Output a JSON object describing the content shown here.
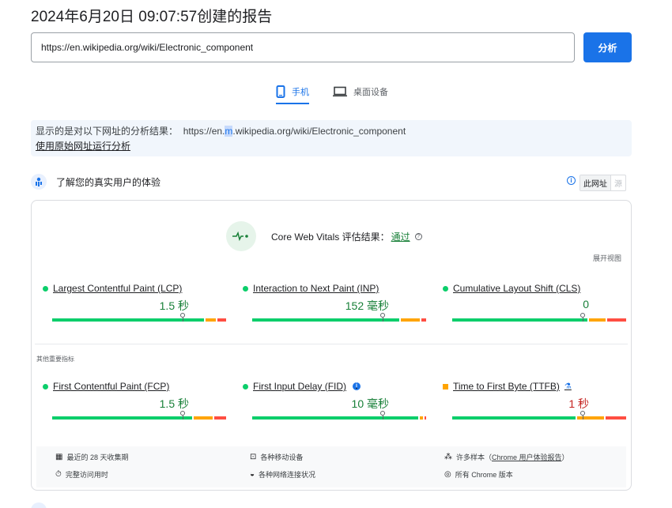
{
  "report_title": "2024年6月20日 09:07:57创建的报告",
  "url_input": "https://en.wikipedia.org/wiki/Electronic_component",
  "analyze_label": "分析",
  "tabs": {
    "mobile": "手机",
    "desktop": "桌面设备"
  },
  "notice": {
    "prefix": "显示的是对以下网址的分析结果：",
    "url_a": "https://en.",
    "url_hl": "m",
    "url_b": ".wikipedia.org/wiki/Electronic_component",
    "link": "使用原始网址运行分析"
  },
  "section": {
    "title": "了解您的真实用户的体验",
    "toggle_on": "此网址",
    "toggle_off": "源"
  },
  "cwv": {
    "label": "Core Web Vitals 评估结果：",
    "result": "通过"
  },
  "expand_label": "展开视图",
  "other_label": "其他重要指标",
  "metrics": [
    {
      "name": "Largest Contentful Paint (LCP)",
      "value": "1.5 秒",
      "status": "good",
      "marker": 0.75,
      "split": [
        0.89,
        0.06,
        0.05
      ]
    },
    {
      "name": "Interaction to Next Paint (INP)",
      "value": "152 毫秒",
      "status": "good",
      "marker": 0.75,
      "split": [
        0.86,
        0.11,
        0.03
      ]
    },
    {
      "name": "Cumulative Layout Shift (CLS)",
      "value": "0",
      "status": "good",
      "marker": 0.75,
      "split": [
        0.79,
        0.1,
        0.11
      ]
    },
    {
      "name": "First Contentful Paint (FCP)",
      "value": "1.5 秒",
      "status": "good",
      "marker": 0.75,
      "split": [
        0.82,
        0.11,
        0.07
      ]
    },
    {
      "name": "First Input Delay (FID)",
      "value": "10 毫秒",
      "status": "good",
      "marker": 0.75,
      "split": [
        0.97,
        0.02,
        0.01
      ]
    },
    {
      "name": "Time to First Byte (TTFB)",
      "value": "1 秒",
      "status": "needs-improvement",
      "marker": 0.75,
      "split": [
        0.72,
        0.16,
        0.12
      ]
    }
  ],
  "footer": {
    "period": "最近的 28 天收集期",
    "devices": "各种移动设备",
    "samples_prefix": "许多样本（",
    "samples_link": "Chrome 用户体验报告",
    "samples_suffix": "）",
    "duration": "完整访问用时",
    "network": "各种网络连接状况",
    "versions": "所有 Chrome 版本"
  },
  "colors": {
    "good": "#0cce6b",
    "average": "#ffa400",
    "poor": "#ff4e42",
    "accent": "#1a73e8",
    "good_text": "#188038",
    "avg_text": "#c5221f"
  }
}
